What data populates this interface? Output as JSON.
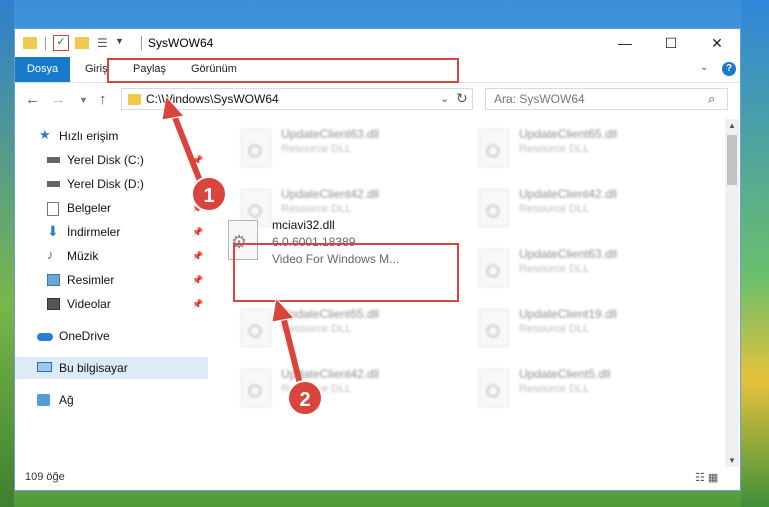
{
  "window": {
    "title": "SysWOW64"
  },
  "ribbon": {
    "tabs": [
      "Dosya",
      "Giriş",
      "Paylaş",
      "Görünüm"
    ],
    "help": "?"
  },
  "window_controls": {
    "minimize": "—",
    "maximize": "☐",
    "close": "✕"
  },
  "nav": {
    "back": "←",
    "forward": "→",
    "recent": "⌄",
    "up": "↑",
    "address": "C:\\Windows\\SysWOW64",
    "refresh": "↻",
    "search_placeholder": "Ara: SysWOW64"
  },
  "sidebar": {
    "items": [
      {
        "label": "Hızlı erişim",
        "icon": "star-icon"
      },
      {
        "label": "Yerel Disk (C:)",
        "icon": "drive-icon"
      },
      {
        "label": "Yerel Disk (D:)",
        "icon": "drive-icon"
      },
      {
        "label": "Belgeler",
        "icon": "documents-icon"
      },
      {
        "label": "İndirmeler",
        "icon": "download-icon"
      },
      {
        "label": "Müzik",
        "icon": "music-icon"
      },
      {
        "label": "Resimler",
        "icon": "pictures-icon"
      },
      {
        "label": "Videolar",
        "icon": "video-icon"
      },
      {
        "label": "OneDrive",
        "icon": "cloud-icon"
      },
      {
        "label": "Bu bilgisayar",
        "icon": "computer-icon"
      },
      {
        "label": "Ağ",
        "icon": "network-icon"
      }
    ]
  },
  "files": [
    {
      "name": "UpdateClient63.dll",
      "desc": "Resource DLL"
    },
    {
      "name": "UpdateClient65.dll",
      "desc": "Resource DLL"
    },
    {
      "name": "UpdateClient42.dll",
      "desc": "Resource DLL"
    },
    {
      "name": "UpdateClient42.dll",
      "desc": "Resource DLL"
    },
    {
      "name": "UpdateClient63.dll",
      "desc": "Resource DLL"
    },
    {
      "name": "UpdateClient65.dll",
      "desc": "Resource DLL"
    },
    {
      "name": "UpdateClient19.dll",
      "desc": "Resource DLL"
    },
    {
      "name": "UpdateClient42.dll",
      "desc": "Resource DLL"
    },
    {
      "name": "UpdateClient5.dll",
      "desc": "Resource DLL"
    }
  ],
  "focused_file": {
    "name": "mciavi32.dll",
    "version": "6.0.6001.18389",
    "desc": "Video For Windows M..."
  },
  "annotations": {
    "step1": "1",
    "step2": "2"
  },
  "status": {
    "count": "109 öğe"
  },
  "colors": {
    "accent": "#1979ca",
    "highlight": "#d9443c"
  }
}
